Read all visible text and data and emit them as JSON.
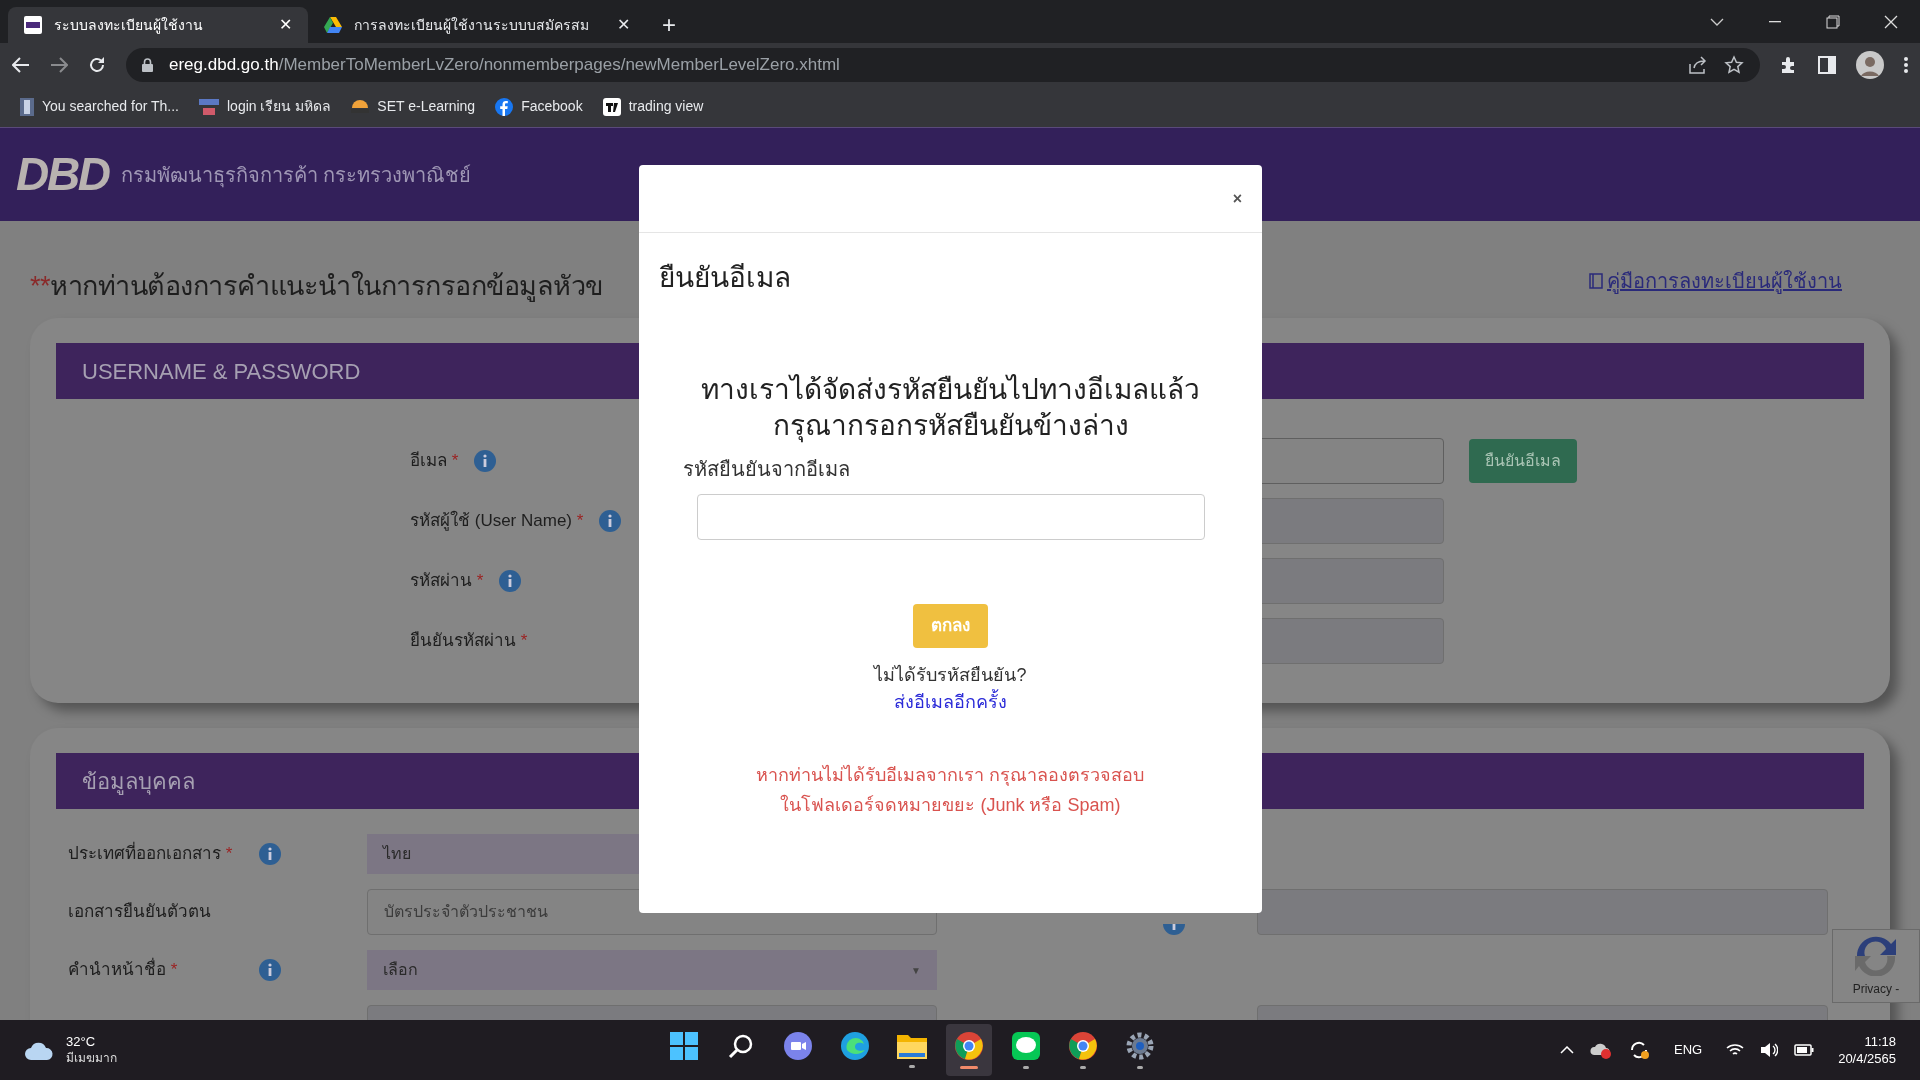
{
  "browser": {
    "tabs": [
      {
        "title": "ระบบลงทะเบียนผู้ใช้งาน",
        "selected": true,
        "close": "✕"
      },
      {
        "title": "การลงทะเบียนผู้ใช้งานระบบบสมัครสม",
        "selected": false,
        "close": "✕"
      }
    ],
    "new_tab": "+",
    "address": {
      "domain": "ereg.dbd.go.th",
      "path": "/MemberToMemberLvZero/nonmemberpages/newMemberLevelZero.xhtml"
    },
    "bookmarks": [
      {
        "label": "You searched for Th..."
      },
      {
        "label": "login เรียน มหิดล"
      },
      {
        "label": "SET e-Learning"
      },
      {
        "label": "Facebook"
      },
      {
        "label": "trading view"
      }
    ]
  },
  "header": {
    "logo": "DBD",
    "org_name": "กรมพัฒนาธุรกิจการค้า กระทรวงพาณิชย์"
  },
  "notice": {
    "prefix": "**",
    "text": "หากท่านต้องการคำแนะนำในการกรอกข้อมูลหัวข"
  },
  "manual_link": "คู่มือการลงทะเบียนผู้ใช้งาน",
  "account_section": {
    "title": "USERNAME & PASSWORD",
    "fields": [
      {
        "label": "อีเมล",
        "required_mark": "*",
        "info": true
      },
      {
        "label": "รหัสผู้ใช้ (User Name)",
        "required_mark": "*",
        "info": true
      },
      {
        "label": "รหัสผ่าน",
        "required_mark": "*",
        "info": true
      },
      {
        "label": "ยืนยันรหัสผ่าน",
        "required_mark": "*",
        "info": false
      }
    ],
    "verify_button": "ยืนยันอีเมล"
  },
  "personal_section": {
    "title": "ข้อมูลบุคคล",
    "rows": [
      {
        "label": "ประเทศที่ออกเอกสาร",
        "required_mark": "*",
        "info": true,
        "kind": "select",
        "value": "ไทย"
      },
      {
        "label": "เอกสารยืนยันตัวตน",
        "info": false,
        "kind": "text",
        "placeholder": "บัตรประจำตัวประชาชน"
      },
      {
        "label": "คำนำหน้าชื่อ",
        "required_mark": "*",
        "info": true,
        "kind": "dropdown",
        "value": "เลือก",
        "caret": "▼"
      }
    ]
  },
  "recaptcha": {
    "label": "Privacy -"
  },
  "modal": {
    "close": "×",
    "title": "ยืนยันอีเมล",
    "message": [
      "ทางเราได้จัดส่งรหัสยืนยันไปทางอีเมลแล้ว",
      "กรุณากรอกรหัสยืนยันข้างล่าง"
    ],
    "code_label": "รหัสยืนยันจากอีเมล",
    "ok_button": "ตกลง",
    "no_code": "ไม่ได้รับรหัสยืนยัน?",
    "resend_link": "ส่งอีเมลอีกครั้ง",
    "junk_notice": [
      "หากท่านไม่ได้รับอีเมลจากเรา กรุณาลองตรวจสอบ",
      "ในโฟลเดอร์จดหมายขยะ (Junk หรือ Spam)"
    ]
  },
  "taskbar": {
    "temperature": "32°C",
    "condition": "มีเมฆมาก",
    "apps": [
      {
        "kind": "start",
        "running": false,
        "selected": false
      },
      {
        "kind": "search",
        "running": false,
        "selected": false
      },
      {
        "kind": "chat",
        "running": false,
        "selected": false
      },
      {
        "kind": "edge",
        "running": false,
        "selected": false
      },
      {
        "kind": "folder",
        "running": true,
        "selected": false
      },
      {
        "kind": "chrome",
        "running": true,
        "selected": true
      },
      {
        "kind": "line",
        "running": true,
        "selected": false
      },
      {
        "kind": "chrome",
        "running": true,
        "selected": false
      },
      {
        "kind": "settings",
        "running": true,
        "selected": false
      }
    ],
    "language": "ENG",
    "time": "11:18",
    "date": "20/4/2565"
  }
}
